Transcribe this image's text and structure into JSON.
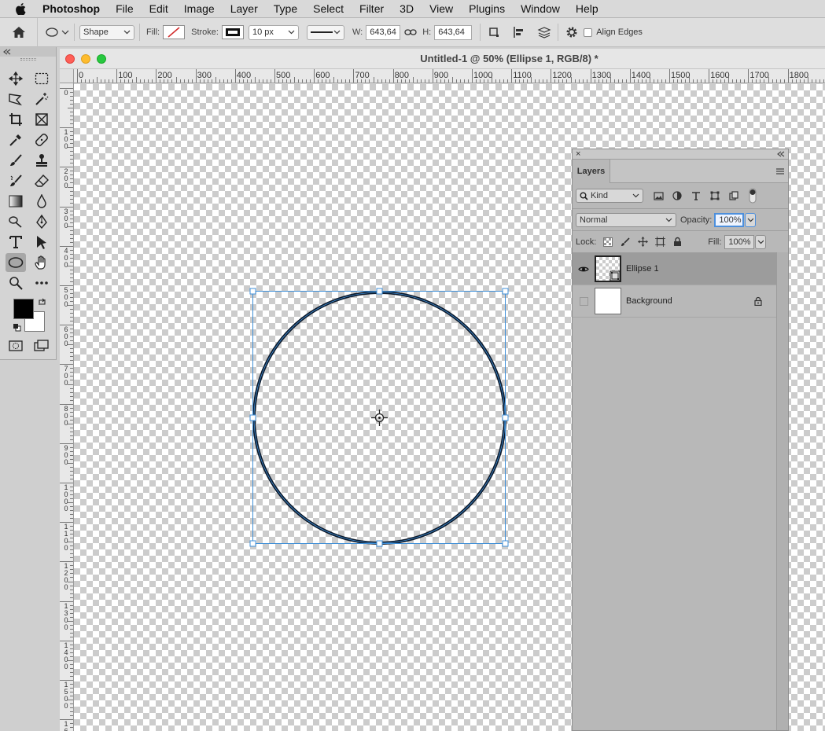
{
  "menubar": {
    "items": [
      "Photoshop",
      "File",
      "Edit",
      "Image",
      "Layer",
      "Type",
      "Select",
      "Filter",
      "3D",
      "View",
      "Plugins",
      "Window",
      "Help"
    ]
  },
  "options": {
    "mode": "Shape",
    "fill_label": "Fill:",
    "stroke_label": "Stroke:",
    "stroke_size": "10 px",
    "w_label": "W:",
    "w_value": "643,64",
    "h_label": "H:",
    "h_value": "643,64",
    "align_edges": "Align Edges"
  },
  "document": {
    "title": "Untitled-1 @ 50% (Ellipse 1, RGB/8) *",
    "ruler_h": [
      "0",
      "100",
      "200",
      "300",
      "400",
      "500",
      "600",
      "700",
      "800",
      "900",
      "1000",
      "1100",
      "1200",
      "1300",
      "1400",
      "1500",
      "1600",
      "1700",
      "1800"
    ],
    "ruler_v": [
      "0",
      "1 0 0",
      "2 0 0",
      "3 0 0",
      "4 0 0",
      "5 0 0",
      "6 0 0",
      "7 0 0",
      "8 0 0",
      "9 0 0",
      "1 0 0 0",
      "1 1 0 0",
      "1 2 0 0",
      "1 3 0 0",
      "1 4 0 0",
      "1 5 0 0",
      "1 6 0 0"
    ]
  },
  "layers_panel": {
    "tab": "Layers",
    "filter_kind": "Kind",
    "blend_mode": "Normal",
    "opacity_label": "Opacity:",
    "opacity_value": "100%",
    "lock_label": "Lock:",
    "fill_label": "Fill:",
    "fill_value": "100%",
    "layers": [
      {
        "name": "Ellipse 1",
        "visible": true,
        "selected": true
      },
      {
        "name": "Background",
        "visible": false,
        "locked": true
      }
    ]
  },
  "colors": {
    "selection": "#3f8fd8",
    "ellipse_stroke": "#0d1a2b",
    "close": "#ff5f57",
    "minimize": "#febc2e",
    "zoom": "#28c840"
  }
}
